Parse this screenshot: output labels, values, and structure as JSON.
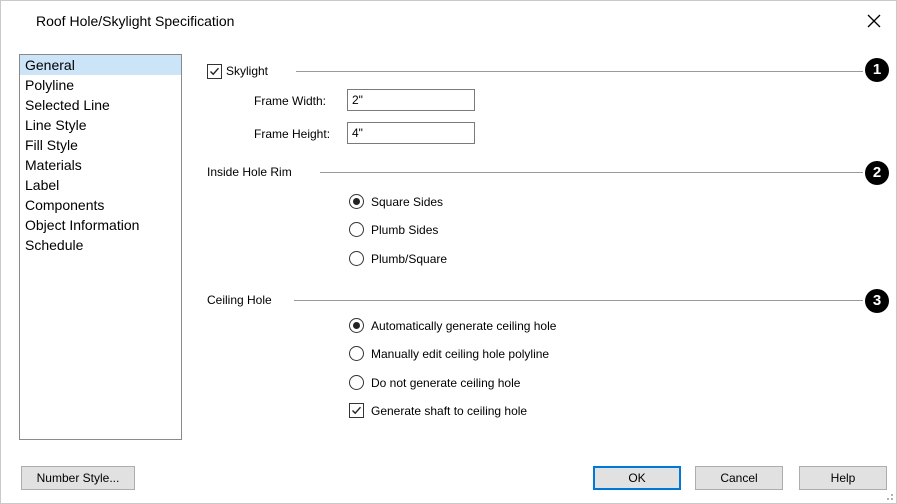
{
  "window": {
    "title": "Roof Hole/Skylight Specification"
  },
  "sidebar": {
    "items": [
      {
        "label": "General"
      },
      {
        "label": "Polyline"
      },
      {
        "label": "Selected Line"
      },
      {
        "label": "Line Style"
      },
      {
        "label": "Fill Style"
      },
      {
        "label": "Materials"
      },
      {
        "label": "Label"
      },
      {
        "label": "Components"
      },
      {
        "label": "Object Information"
      },
      {
        "label": "Schedule"
      }
    ]
  },
  "skylight": {
    "checkbox_label": "Skylight",
    "checked": true,
    "frame_width_label": "Frame Width:",
    "frame_width_value": "2\"",
    "frame_height_label": "Frame Height:",
    "frame_height_value": "4\""
  },
  "rim": {
    "title": "Inside Hole Rim",
    "options": [
      {
        "label": "Square Sides",
        "selected": true
      },
      {
        "label": "Plumb Sides",
        "selected": false
      },
      {
        "label": "Plumb/Square",
        "selected": false
      }
    ]
  },
  "ceiling": {
    "title": "Ceiling Hole",
    "options": [
      {
        "label": "Automatically generate ceiling hole",
        "selected": true
      },
      {
        "label": "Manually edit ceiling hole polyline",
        "selected": false
      },
      {
        "label": "Do not generate ceiling hole",
        "selected": false
      }
    ],
    "shaft_label": "Generate shaft to ceiling hole",
    "shaft_checked": true
  },
  "callouts": [
    "1",
    "2",
    "3"
  ],
  "buttons": {
    "number_style": "Number Style...",
    "ok": "OK",
    "cancel": "Cancel",
    "help": "Help"
  }
}
